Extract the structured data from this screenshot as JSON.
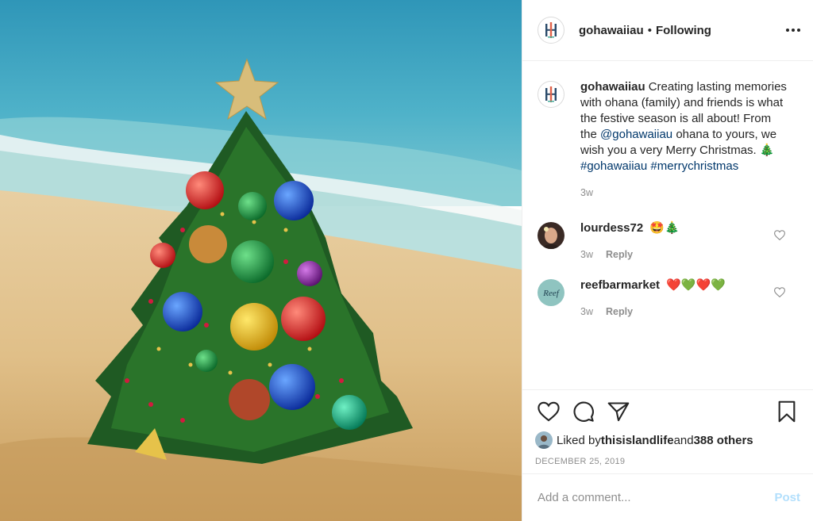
{
  "post": {
    "username": "gohawaiiau",
    "follow_status": "Following",
    "separator": "•"
  },
  "caption": {
    "username": "gohawaiiau",
    "text_1": "Creating lasting memories with ohana (family) and friends is what the festive season is all about! From the ",
    "mention": "@gohawaiiau",
    "text_2": " ohana to yours, we wish you a very Merry Christmas. 🎄 ",
    "hashtag_1": "#gohawaiiau",
    "hashtag_2": "#merrychristmas",
    "time": "3w"
  },
  "comments": [
    {
      "username": "lourdess72",
      "text": "🤩🎄",
      "time": "3w",
      "reply": "Reply"
    },
    {
      "username": "reefbarmarket",
      "text": "❤️💚❤️💚",
      "time": "3w",
      "reply": "Reply"
    }
  ],
  "likes": {
    "prefix": "Liked by ",
    "user": "thisislandlife",
    "middle": " and ",
    "others": "388 others"
  },
  "date": "DECEMBER 25, 2019",
  "comment_input": {
    "placeholder": "Add a comment..."
  },
  "post_button": "Post",
  "logo_text": "HI",
  "reef_logo_text": "Reef",
  "colors": {
    "link": "#00376b",
    "post_button_disabled": "#b2dffc",
    "secondary_text": "#8e8e8e"
  },
  "icons": [
    "heart-icon",
    "comment-icon",
    "share-icon",
    "bookmark-icon",
    "more-icon"
  ]
}
